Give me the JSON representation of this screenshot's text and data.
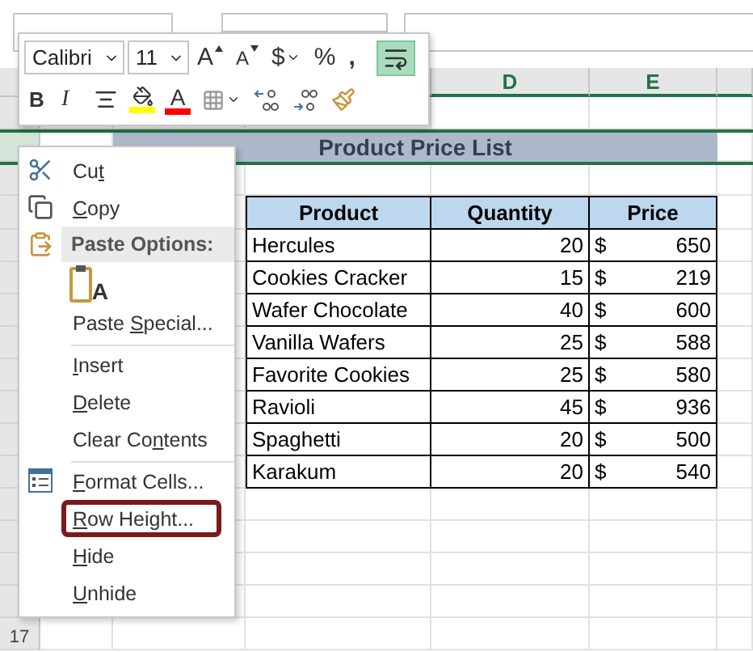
{
  "column_headers": [
    "D",
    "E"
  ],
  "row_headers": [
    {
      "label": "17"
    }
  ],
  "sheet": {
    "title": "Product Price List",
    "columns": [
      "Product",
      "Quantity",
      "Price"
    ],
    "rows": [
      {
        "product": "Hercules",
        "quantity": "20",
        "currency": "$",
        "price": "650"
      },
      {
        "product": "Cookies Cracker",
        "quantity": "15",
        "currency": "$",
        "price": "219"
      },
      {
        "product": "Wafer Chocolate",
        "quantity": "40",
        "currency": "$",
        "price": "600"
      },
      {
        "product": "Vanilla Wafers",
        "quantity": "25",
        "currency": "$",
        "price": "588"
      },
      {
        "product": "Favorite Cookies",
        "quantity": "25",
        "currency": "$",
        "price": "580"
      },
      {
        "product": "Ravioli",
        "quantity": "45",
        "currency": "$",
        "price": "936"
      },
      {
        "product": "Spaghetti",
        "quantity": "20",
        "currency": "$",
        "price": "500"
      },
      {
        "product": "Karakum",
        "quantity": "20",
        "currency": "$",
        "price": "540"
      }
    ]
  },
  "mini_toolbar": {
    "row_1": [
      {
        "kind": "font",
        "text": "Calibri"
      },
      {
        "kind": "size",
        "text": "11"
      },
      {
        "kind": "grow",
        "text": "A"
      },
      {
        "kind": "shrink",
        "text": "A"
      },
      {
        "kind": "currency",
        "text": "$"
      },
      {
        "kind": "percent",
        "text": "%"
      },
      {
        "kind": "comma",
        "text": ","
      },
      {
        "kind": "wrap",
        "selected": true
      }
    ],
    "row_2": [
      {
        "kind": "bold",
        "text": "B"
      },
      {
        "kind": "italic",
        "text": "I"
      },
      {
        "kind": "align"
      },
      {
        "kind": "fill",
        "color": "#ffff00"
      },
      {
        "kind": "font-color",
        "text": "A",
        "color": "#ff0000"
      },
      {
        "kind": "borders"
      },
      {
        "kind": "inc-decimal"
      },
      {
        "kind": "dec-decimal"
      },
      {
        "kind": "painter"
      }
    ]
  },
  "context_menu": [
    {
      "kind": "item",
      "parts": [
        {
          "text": "Cu"
        },
        {
          "text": "t",
          "underlined": true
        }
      ],
      "highlighted": false
    },
    {
      "kind": "item",
      "parts": [
        {
          "text": "C",
          "underlined": true
        },
        {
          "text": "opy"
        }
      ],
      "highlighted": false
    },
    {
      "kind": "header",
      "text": "Paste Options:"
    },
    {
      "kind": "paste-option",
      "text": "A"
    },
    {
      "kind": "item",
      "parts": [
        {
          "text": "Paste "
        },
        {
          "text": "S",
          "underlined": true
        },
        {
          "text": "pecial..."
        }
      ],
      "highlighted": false
    },
    {
      "kind": "separator"
    },
    {
      "kind": "item",
      "parts": [
        {
          "text": "I",
          "underlined": true
        },
        {
          "text": "nsert"
        }
      ],
      "highlighted": false
    },
    {
      "kind": "item",
      "parts": [
        {
          "text": "D",
          "underlined": true
        },
        {
          "text": "elete"
        }
      ],
      "highlighted": false
    },
    {
      "kind": "item",
      "parts": [
        {
          "text": "Clear Co"
        },
        {
          "text": "n",
          "underlined": true
        },
        {
          "text": "tents"
        }
      ],
      "highlighted": false
    },
    {
      "kind": "separator"
    },
    {
      "kind": "item",
      "parts": [
        {
          "text": "F",
          "underlined": true
        },
        {
          "text": "ormat Cells..."
        }
      ],
      "highlighted": false
    },
    {
      "kind": "item",
      "parts": [
        {
          "text": "R",
          "underlined": true
        },
        {
          "text": "ow Height..."
        }
      ],
      "highlighted": true
    },
    {
      "kind": "item",
      "parts": [
        {
          "text": "H",
          "underlined": true
        },
        {
          "text": "ide"
        }
      ],
      "highlighted": false
    },
    {
      "kind": "item",
      "parts": [
        {
          "text": "U",
          "underlined": true
        },
        {
          "text": "nhide"
        }
      ],
      "highlighted": false
    }
  ]
}
